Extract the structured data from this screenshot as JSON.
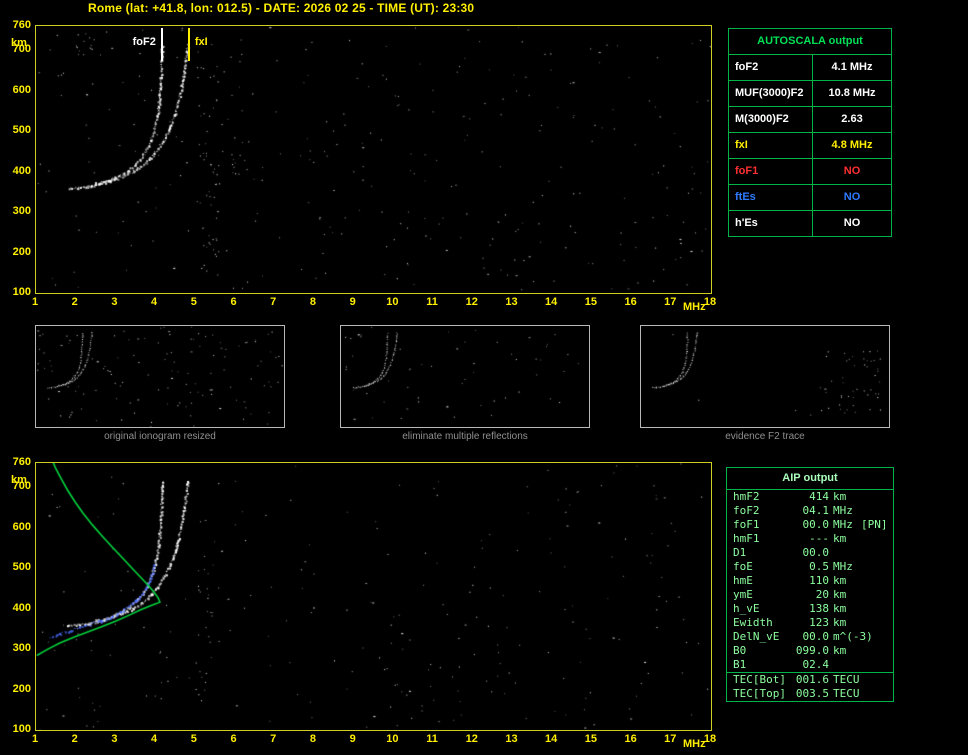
{
  "header": {
    "title": "Rome (lat: +41.8, lon: 012.5) - DATE: 2026 02 25 - TIME (UT): 23:30"
  },
  "autoscala": {
    "title": "AUTOSCALA output",
    "rows": [
      {
        "label": "foF2",
        "value": "4.1 MHz",
        "color": "#ffffff"
      },
      {
        "label": "MUF(3000)F2",
        "value": "10.8 MHz",
        "color": "#ffffff"
      },
      {
        "label": "M(3000)F2",
        "value": "2.63",
        "color": "#ffffff"
      },
      {
        "label": "fxI",
        "value": "4.8 MHz",
        "color": "#ffee00"
      },
      {
        "label": "foF1",
        "value": "NO",
        "color": "#ff3030"
      },
      {
        "label": "ftEs",
        "value": "NO",
        "color": "#2e7bff"
      },
      {
        "label": "h'Es",
        "value": "NO",
        "color": "#ffffff"
      }
    ]
  },
  "aip": {
    "title": "AIP output",
    "rows": [
      {
        "label": "hmF2",
        "value": "414",
        "unit": "km",
        "extra": ""
      },
      {
        "label": "foF2",
        "value": "04.1",
        "unit": "MHz",
        "extra": ""
      },
      {
        "label": "foF1",
        "value": "00.0",
        "unit": "MHz",
        "extra": "[PN]"
      },
      {
        "label": "hmF1",
        "value": "---",
        "unit": "km",
        "extra": ""
      },
      {
        "label": "D1",
        "value": "00.0",
        "unit": "",
        "extra": ""
      },
      {
        "label": "foE",
        "value": "0.5",
        "unit": "MHz",
        "extra": ""
      },
      {
        "label": "hmE",
        "value": "110",
        "unit": "km",
        "extra": ""
      },
      {
        "label": "ymE",
        "value": "20",
        "unit": "km",
        "extra": ""
      },
      {
        "label": "h_vE",
        "value": "138",
        "unit": "km",
        "extra": ""
      },
      {
        "label": "Ewidth",
        "value": "123",
        "unit": "km",
        "extra": ""
      },
      {
        "label": "DelN_vE",
        "value": "00.0",
        "unit": "m^(-3)",
        "extra": ""
      },
      {
        "label": "B0",
        "value": "099.0",
        "unit": "km",
        "extra": ""
      },
      {
        "label": "B1",
        "value": "02.4",
        "unit": "",
        "extra": ""
      }
    ],
    "tec_rows": [
      {
        "label": "TEC[Bot]",
        "value": "001.6",
        "unit": "TECU"
      },
      {
        "label": "TEC[Top]",
        "value": "003.5",
        "unit": "TECU"
      }
    ]
  },
  "thumbnails": [
    {
      "caption": "original ionogram resized",
      "seed": 11,
      "noise": 130,
      "patches": []
    },
    {
      "caption": "eliminate multiple reflections",
      "seed": 22,
      "noise": 55,
      "patches": []
    },
    {
      "caption": "evidence F2 trace",
      "seed": 33,
      "noise": 8,
      "patches": [
        {
          "f": [
            13.0,
            17.4
          ],
          "km": [
            190,
            600
          ],
          "count": 45
        }
      ]
    }
  ],
  "chart_data": [
    {
      "id": "ionogram",
      "type": "scatter",
      "title": "",
      "xlabel": "MHz",
      "ylabel": "km",
      "xlim": [
        1,
        18
      ],
      "ylim": [
        100,
        760
      ],
      "x_ticks": [
        1,
        2,
        3,
        4,
        5,
        6,
        7,
        8,
        9,
        10,
        11,
        12,
        13,
        14,
        15,
        16,
        17,
        18
      ],
      "y_ticks": [
        760,
        700,
        600,
        500,
        400,
        300,
        200,
        100
      ],
      "markers": [
        {
          "label": "foF2",
          "freq": 4.17,
          "color": "#ffffff",
          "side": "left"
        },
        {
          "label": "fxI",
          "freq": 4.85,
          "color": "#ffee00",
          "side": "right"
        }
      ],
      "series": [
        {
          "name": "F2-ordinary-trace",
          "color": "#ffffff",
          "style": "dots",
          "points": [
            [
              1.8,
              360
            ],
            [
              2.05,
              361
            ],
            [
              2.3,
              364
            ],
            [
              2.55,
              369
            ],
            [
              2.8,
              377
            ],
            [
              3.05,
              388
            ],
            [
              3.3,
              402
            ],
            [
              3.5,
              419
            ],
            [
              3.68,
              440
            ],
            [
              3.82,
              463
            ],
            [
              3.93,
              490
            ],
            [
              4.01,
              520
            ],
            [
              4.07,
              555
            ],
            [
              4.11,
              595
            ],
            [
              4.14,
              640
            ],
            [
              4.16,
              690
            ],
            [
              4.17,
              715
            ]
          ]
        },
        {
          "name": "F2-extraordinary-trace",
          "color": "#ffffff",
          "style": "dots",
          "points": [
            [
              2.45,
              371
            ],
            [
              2.7,
              375
            ],
            [
              2.95,
              381
            ],
            [
              3.2,
              390
            ],
            [
              3.45,
              402
            ],
            [
              3.68,
              417
            ],
            [
              3.88,
              435
            ],
            [
              4.06,
              456
            ],
            [
              4.22,
              480
            ],
            [
              4.36,
              508
            ],
            [
              4.48,
              540
            ],
            [
              4.58,
              575
            ],
            [
              4.67,
              615
            ],
            [
              4.74,
              658
            ],
            [
              4.79,
              700
            ],
            [
              4.82,
              718
            ]
          ]
        }
      ],
      "noise": {
        "seed": 7,
        "count": 300,
        "patches": [
          {
            "f": [
              5.05,
              5.6
            ],
            "km": [
              140,
              700
            ],
            "count": 55
          },
          {
            "f": [
              5.9,
              6.35
            ],
            "km": [
              380,
              700
            ],
            "count": 16
          },
          {
            "f": [
              1.9,
              2.6
            ],
            "km": [
              690,
              748
            ],
            "count": 12
          }
        ]
      }
    },
    {
      "id": "profile",
      "type": "scatter",
      "title": "",
      "xlabel": "MHz",
      "ylabel": "km",
      "xlim": [
        1,
        18
      ],
      "ylim": [
        100,
        760
      ],
      "x_ticks": [
        1,
        2,
        3,
        4,
        5,
        6,
        7,
        8,
        9,
        10,
        11,
        12,
        13,
        14,
        15,
        16,
        17,
        18
      ],
      "y_ticks": [
        760,
        700,
        600,
        500,
        400,
        300,
        200,
        100
      ],
      "markers": [],
      "series": [
        {
          "name": "F2-ordinary-trace",
          "color": "#ffffff",
          "style": "dots",
          "points": [
            [
              1.8,
              360
            ],
            [
              2.05,
              361
            ],
            [
              2.3,
              364
            ],
            [
              2.55,
              369
            ],
            [
              2.8,
              377
            ],
            [
              3.05,
              388
            ],
            [
              3.3,
              402
            ],
            [
              3.5,
              419
            ],
            [
              3.68,
              440
            ],
            [
              3.82,
              463
            ],
            [
              3.93,
              490
            ],
            [
              4.01,
              520
            ],
            [
              4.07,
              555
            ],
            [
              4.11,
              595
            ],
            [
              4.14,
              640
            ],
            [
              4.16,
              690
            ],
            [
              4.17,
              715
            ]
          ]
        },
        {
          "name": "F2-extraordinary-trace",
          "color": "#ffffff",
          "style": "dots",
          "points": [
            [
              2.45,
              371
            ],
            [
              2.7,
              375
            ],
            [
              2.95,
              381
            ],
            [
              3.2,
              390
            ],
            [
              3.45,
              402
            ],
            [
              3.68,
              417
            ],
            [
              3.88,
              435
            ],
            [
              4.06,
              456
            ],
            [
              4.22,
              480
            ],
            [
              4.36,
              508
            ],
            [
              4.48,
              540
            ],
            [
              4.58,
              575
            ],
            [
              4.67,
              615
            ],
            [
              4.74,
              658
            ],
            [
              4.79,
              700
            ],
            [
              4.82,
              718
            ]
          ]
        },
        {
          "name": "restored-trace",
          "color": "#4d6dff",
          "style": "dots",
          "points": [
            [
              1.35,
              328
            ],
            [
              1.6,
              338
            ],
            [
              1.85,
              347
            ],
            [
              2.1,
              355
            ],
            [
              2.35,
              362
            ],
            [
              2.6,
              370
            ],
            [
              2.85,
              379
            ],
            [
              3.1,
              391
            ],
            [
              3.3,
              404
            ],
            [
              3.5,
              420
            ],
            [
              3.68,
              440
            ],
            [
              3.82,
              462
            ],
            [
              3.92,
              488
            ],
            [
              3.99,
              515
            ]
          ]
        },
        {
          "name": "electron-density-profile",
          "color": "#00d23c",
          "style": "line",
          "points": [
            [
              1.02,
              284
            ],
            [
              1.3,
              300
            ],
            [
              1.6,
              315
            ],
            [
              1.95,
              329
            ],
            [
              2.3,
              342
            ],
            [
              2.65,
              355
            ],
            [
              3.0,
              369
            ],
            [
              3.35,
              384
            ],
            [
              3.65,
              398
            ],
            [
              3.9,
              408
            ],
            [
              4.05,
              413
            ],
            [
              4.12,
              416
            ],
            [
              4.08,
              426
            ],
            [
              3.98,
              440
            ],
            [
              3.83,
              457
            ],
            [
              3.64,
              477
            ],
            [
              3.42,
              500
            ],
            [
              3.18,
              525
            ],
            [
              2.93,
              551
            ],
            [
              2.67,
              579
            ],
            [
              2.42,
              607
            ],
            [
              2.19,
              635
            ],
            [
              1.99,
              663
            ],
            [
              1.8,
              692
            ],
            [
              1.63,
              722
            ],
            [
              1.49,
              748
            ],
            [
              1.43,
              762
            ]
          ]
        }
      ],
      "noise": {
        "seed": 17,
        "count": 230,
        "patches": [
          {
            "f": [
              5.0,
              5.5
            ],
            "km": [
              150,
              650
            ],
            "count": 28
          },
          {
            "f": [
              10.0,
              13.5
            ],
            "km": [
              120,
              320
            ],
            "count": 18
          }
        ]
      }
    }
  ]
}
